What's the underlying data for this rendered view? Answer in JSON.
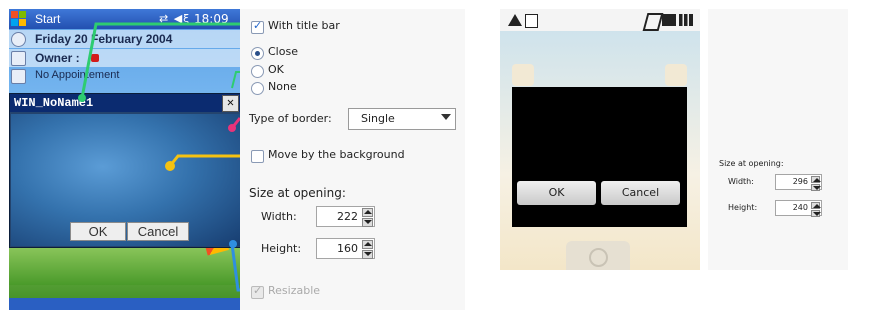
{
  "pocket_pc": {
    "taskbar": {
      "start_label": "Start",
      "status_icons": "⇄ ◀ξ",
      "time": "18:09"
    },
    "today": {
      "date": "Friday 20 February 2004",
      "owner_label": "Owner :",
      "appointment": "No Appointement"
    },
    "dialog": {
      "title": "WIN_NoName1",
      "close_glyph": "✕",
      "ok_label": "OK",
      "cancel_label": "Cancel"
    },
    "colors": {
      "anno_green": "#2ecc71",
      "anno_pink": "#e8337a",
      "anno_yellow": "#f5c211",
      "anno_blue": "#2f8fe0"
    }
  },
  "settings": {
    "title_bar": {
      "label": "With title bar",
      "checked": true
    },
    "buttons": {
      "options": [
        "Close",
        "OK",
        "None"
      ],
      "selected": "Close"
    },
    "border": {
      "label": "Type of border:",
      "value": "Single"
    },
    "move_bg": {
      "label": "Move by the background",
      "checked": false
    },
    "size": {
      "heading": "Size at opening:",
      "width_label": "Width:",
      "width_value": "222",
      "height_label": "Height:",
      "height_value": "160"
    },
    "resizable": {
      "label": "Resizable",
      "checked": true,
      "disabled": true
    }
  },
  "android": {
    "dialog": {
      "ok_label": "OK",
      "cancel_label": "Cancel"
    },
    "size": {
      "heading": "Size at opening:",
      "width_label": "Width:",
      "width_value": "296",
      "height_label": "Height:",
      "height_value": "240"
    }
  }
}
